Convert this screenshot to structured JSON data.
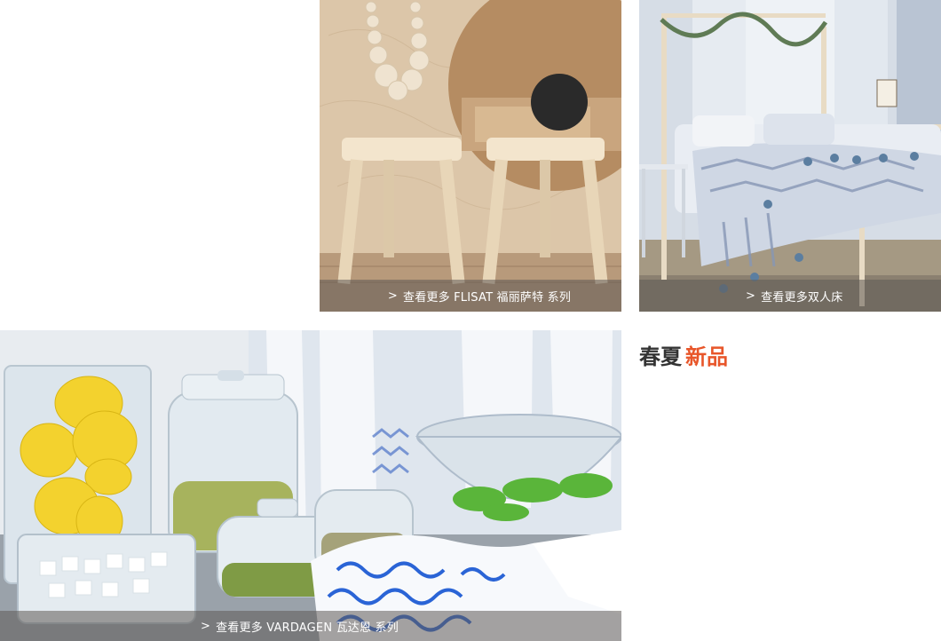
{
  "tiles": {
    "stools": {
      "caption": "查看更多 FLISAT 福丽萨特 系列",
      "arrow": ">",
      "image": "flisat-stools-photo"
    },
    "bed": {
      "caption": "查看更多双人床",
      "arrow": ">",
      "image": "double-bed-photo"
    },
    "jars": {
      "caption": "查看更多 VARDAGEN 瓦达恩 系列",
      "arrow": ">",
      "image": "vardagen-jars-photo"
    }
  },
  "section": {
    "title_main": "春夏",
    "title_accent": "新品"
  },
  "colors": {
    "accent": "#e8562a",
    "title": "#333333",
    "caption_bg": "#5f5a55"
  }
}
